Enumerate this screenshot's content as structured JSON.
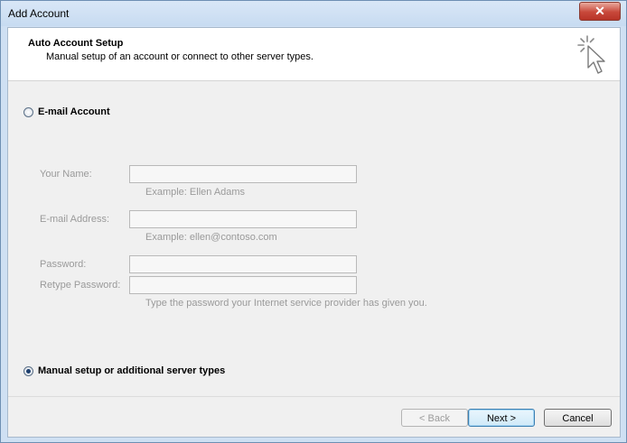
{
  "window": {
    "title": "Add Account",
    "close_label": "✕"
  },
  "header": {
    "title": "Auto Account Setup",
    "subtitle": "Manual setup of an account or connect to other server types.",
    "icon": "cursor-sparkle-icon"
  },
  "options": {
    "email_account": {
      "label": "E-mail Account",
      "selected": false
    },
    "manual_setup": {
      "label": "Manual setup or additional server types",
      "selected": true
    }
  },
  "form": {
    "your_name": {
      "label": "Your Name:",
      "value": "",
      "hint": "Example: Ellen Adams"
    },
    "email_address": {
      "label": "E-mail Address:",
      "value": "",
      "hint": "Example: ellen@contoso.com"
    },
    "password": {
      "label": "Password:",
      "value": ""
    },
    "retype_password": {
      "label": "Retype Password:",
      "value": "",
      "hint": "Type the password your Internet service provider has given you."
    }
  },
  "buttons": {
    "back": "< Back",
    "next": "Next >",
    "cancel": "Cancel"
  }
}
